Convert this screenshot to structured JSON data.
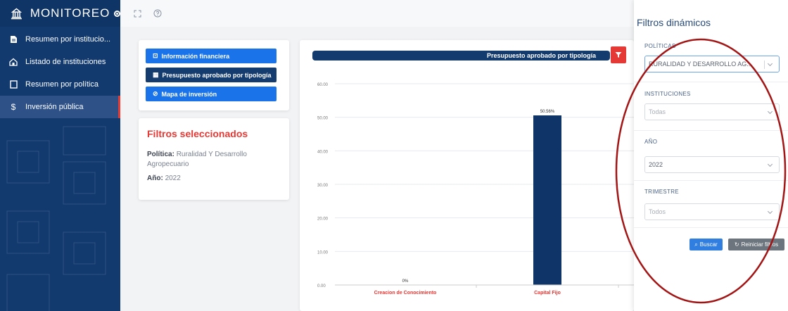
{
  "sidebar": {
    "title": "MONITOREO",
    "items": [
      {
        "label": "Resumen por institucio...",
        "icon": "document-icon"
      },
      {
        "label": "Listado de instituciones",
        "icon": "home-icon"
      },
      {
        "label": "Resumen por política",
        "icon": "square-icon"
      },
      {
        "label": "Inversión pública",
        "icon": "dollar-icon",
        "active": true
      }
    ]
  },
  "buttons": {
    "financiera": "Información financiera",
    "presupuesto": "Presupuesto aprobado por tipología",
    "mapa": "Mapa de inversión"
  },
  "selected_filters": {
    "title": "Filtros seleccionados",
    "politica_label": "Política:",
    "politica_value": "Ruralidad Y Desarrollo Agropecuario",
    "anio_label": "Año:",
    "anio_value": "2022"
  },
  "chart_data": {
    "type": "bar",
    "title": "Presupuesto aprobado por tipología",
    "categories": [
      "Creacion de Conocimiento",
      "Capital Fijo"
    ],
    "values": [
      0,
      50.56
    ],
    "data_labels": [
      "0%",
      "50.56%"
    ],
    "ylim": [
      0,
      60
    ],
    "yticks": [
      "0.00",
      "10.00",
      "20.00",
      "30.00",
      "40.00",
      "50.00",
      "60.00"
    ],
    "grid": true,
    "bar_color": "#0f3468",
    "category_color": "#e53935"
  },
  "right_panel": {
    "title": "Filtros dinámicos",
    "politicas_label": "POLÍTICAS",
    "politicas_value": "RURALIDAD Y DESARROLLO AG...",
    "instituciones_label": "INSTITUCIONES",
    "instituciones_placeholder": "Todas",
    "anio_label": "AÑO",
    "anio_value": "2022",
    "trimestre_label": "TRIMESTRE",
    "trimestre_placeholder": "Todos",
    "search_label": "Buscar",
    "reset_label": "Reiniciar filtros"
  },
  "colors": {
    "sidebar": "#123a6e",
    "accent_red": "#e53935",
    "primary_blue": "#1a73e8",
    "annotation": "#a31515"
  }
}
